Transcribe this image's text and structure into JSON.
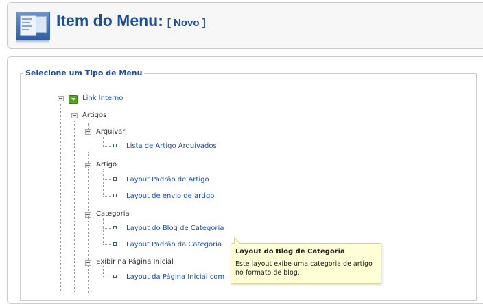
{
  "header": {
    "title": "Item do Menu:",
    "subtitle": "[ Novo ]"
  },
  "fieldset": {
    "legend": "Selecione um Tipo de Menu"
  },
  "tree": {
    "root": "Link Interno",
    "artigos": "Artigos",
    "arquivar": "Arquivar",
    "arquivar_items": [
      "Lista de Artigo Arquivados"
    ],
    "artigo": "Artigo",
    "artigo_items": [
      "Layout Padrão de Artigo",
      "Layout de envio de artigo"
    ],
    "categoria": "Categoria",
    "categoria_items": [
      "Layout do Blog de Categoria",
      "Layout Padrão da Categoria"
    ],
    "pagina_inicial": "Exibir na Página Inicial",
    "pagina_inicial_items": [
      "Layout da Página Inicial com"
    ]
  },
  "tooltip": {
    "title": "Layout do Blog de Categoria",
    "body": "Este layout exibe uma categoria de artigo no formato de blog."
  },
  "colors": {
    "title_blue": "#1b4f9c",
    "link_blue": "#1a4fae",
    "tooltip_bg": "#ffffd6",
    "tree_icon_green": "#51a51e"
  },
  "icons": {
    "header": "menu-item-icon",
    "root": "green-dropdown-icon"
  }
}
